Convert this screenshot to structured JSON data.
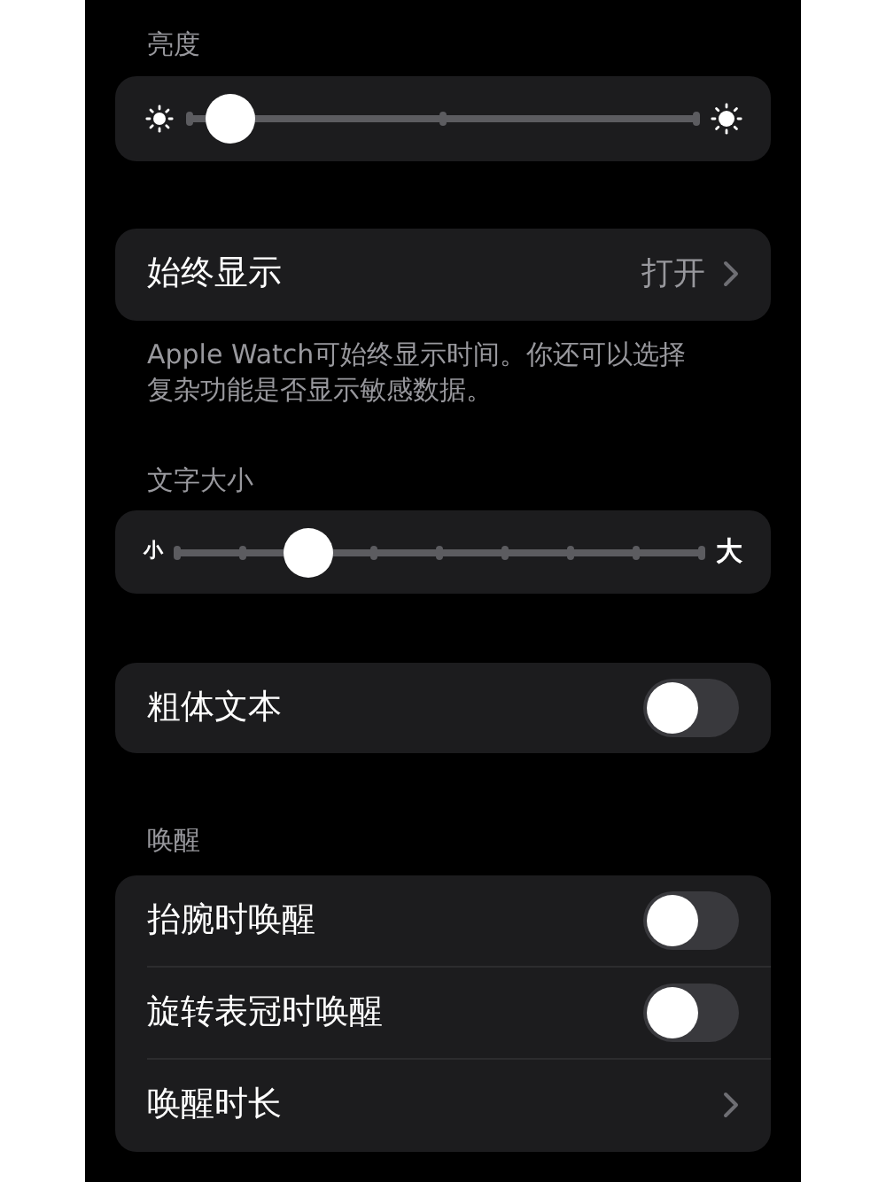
{
  "brightness": {
    "header": "亮度",
    "level": 0.08
  },
  "always_on": {
    "label": "始终显示",
    "value": "打开",
    "description": "Apple Watch可始终显示时间。你还可以选择复杂功能是否显示敏感数据。"
  },
  "text_size": {
    "header": "文字大小",
    "small_label": "小",
    "large_label": "大",
    "level": 0.25
  },
  "bold_text": {
    "label": "粗体文本",
    "on": false
  },
  "wake": {
    "header": "唤醒",
    "rows": [
      {
        "kind": "toggle",
        "label": "抬腕时唤醒",
        "on": false
      },
      {
        "kind": "toggle",
        "label": "旋转表冠时唤醒",
        "on": false
      },
      {
        "kind": "link",
        "label": "唤醒时长"
      }
    ]
  }
}
